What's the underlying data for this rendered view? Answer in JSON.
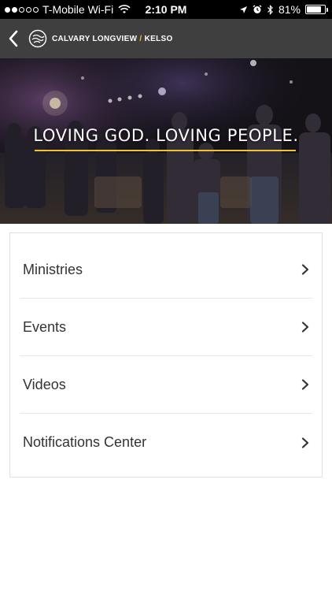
{
  "status_bar": {
    "carrier": "T-Mobile Wi-Fi",
    "time": "2:10 PM",
    "battery": "81%",
    "battery_level": 0.81,
    "signal_filled": 2,
    "signal_total": 5,
    "icons": [
      "wifi-icon",
      "location-icon",
      "alarm-icon",
      "bluetooth-icon",
      "battery-icon"
    ]
  },
  "nav": {
    "church_name": "CALVARY LONGVIEW",
    "separator": "/",
    "campus": "KELSO",
    "back_icon": "chevron-left-icon",
    "logo_icon": "calvary-logo-icon"
  },
  "hero": {
    "tagline": "LOVING GOD.  LOVING PEOPLE."
  },
  "menu": {
    "items": [
      {
        "label": "Ministries"
      },
      {
        "label": "Events"
      },
      {
        "label": "Videos"
      },
      {
        "label": "Notifications Center"
      }
    ]
  },
  "colors": {
    "status_bar_bg": "#000000",
    "nav_bg": "#3f3f3f",
    "accent": "#f1c232",
    "menu_text": "#333333",
    "chevron": "#333333"
  }
}
